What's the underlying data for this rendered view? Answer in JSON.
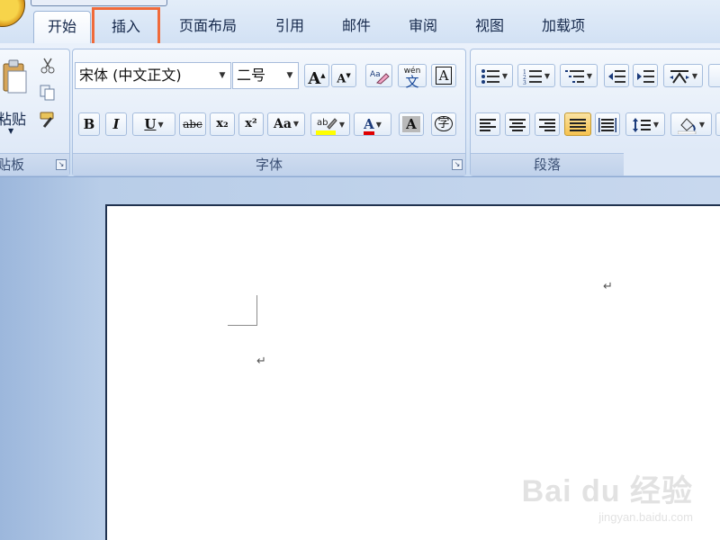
{
  "tabs": [
    {
      "label": "开始",
      "active": true
    },
    {
      "label": "插入",
      "highlighted": true
    },
    {
      "label": "页面布局"
    },
    {
      "label": "引用"
    },
    {
      "label": "邮件"
    },
    {
      "label": "审阅"
    },
    {
      "label": "视图"
    },
    {
      "label": "加载项"
    }
  ],
  "clipboard": {
    "paste_label": "粘贴",
    "group_label": "贴板"
  },
  "font": {
    "font_name": "宋体 (中文正文)",
    "font_size": "二号",
    "group_label": "字体",
    "buttons": {
      "bold": "B",
      "italic": "I",
      "underline": "U",
      "strike": "abc",
      "subscript": "x₂",
      "superscript": "x²",
      "change_case": "Aa",
      "grow": "A",
      "shrink": "A",
      "font_color": "A",
      "shading": "A",
      "border_char": "A",
      "enclose_char": "字",
      "phonetic": "wén",
      "phonetic_char": "文"
    }
  },
  "paragraph": {
    "group_label": "段落"
  },
  "document": {
    "paragraph_mark": "↵"
  },
  "watermark": {
    "logo": "Bai du 经验",
    "url": "jingyan.baidu.com"
  },
  "colors": {
    "highlight_tab_outline": "#f06a3a",
    "ribbon_bg": "#dce8f7",
    "font_color_bar": "#e00000",
    "highlight_bar": "#ffff00"
  }
}
